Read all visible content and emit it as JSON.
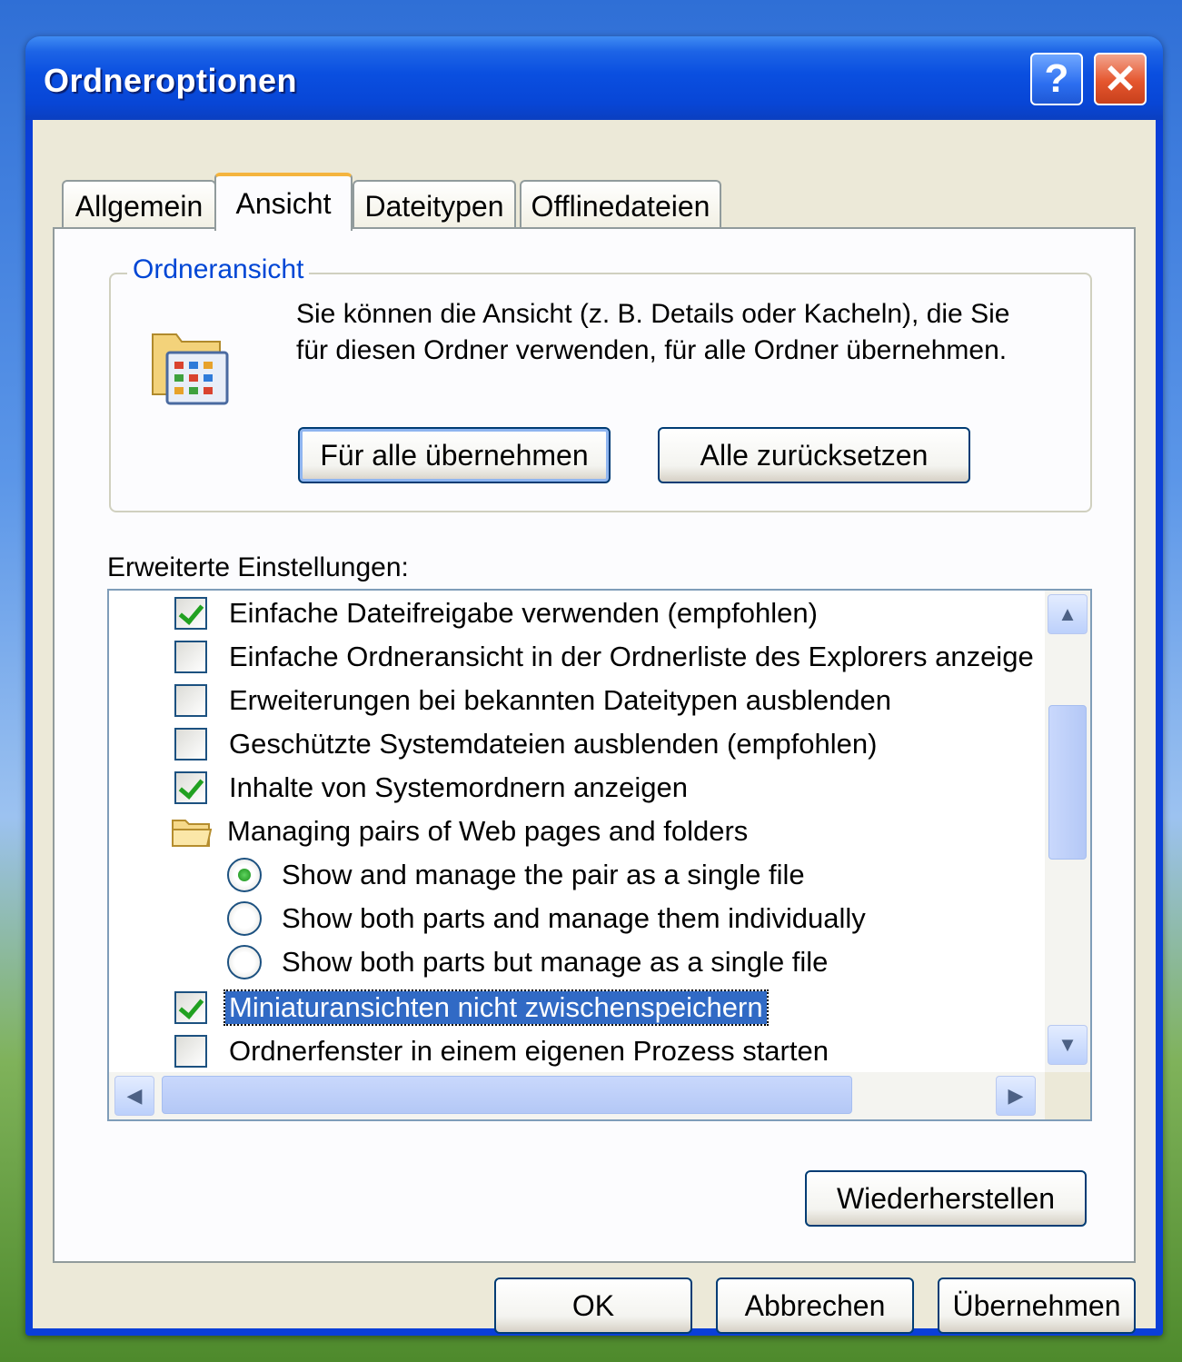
{
  "window": {
    "title": "Ordneroptionen",
    "help_label": "?",
    "close_label": "✕"
  },
  "tabs": [
    {
      "label": "Allgemein",
      "active": false
    },
    {
      "label": "Ansicht",
      "active": true
    },
    {
      "label": "Dateitypen",
      "active": false
    },
    {
      "label": "Offlinedateien",
      "active": false
    }
  ],
  "folder_view": {
    "title": "Ordneransicht",
    "description": "Sie können die Ansicht (z. B. Details oder Kacheln), die Sie für diesen Ordner verwenden, für alle Ordner übernehmen.",
    "apply_all_label": "Für alle übernehmen",
    "reset_all_label": "Alle zurücksetzen",
    "icon": "folder-view-icon"
  },
  "advanced": {
    "label": "Erweiterte Einstellungen:",
    "items": [
      {
        "type": "checkbox",
        "label": "Einfache Dateifreigabe verwenden (empfohlen)",
        "checked": true
      },
      {
        "type": "checkbox",
        "label": "Einfache Ordneransicht in der Ordnerliste des Explorers anzeige",
        "checked": false
      },
      {
        "type": "checkbox",
        "label": "Erweiterungen bei bekannten Dateitypen ausblenden",
        "checked": false
      },
      {
        "type": "checkbox",
        "label": "Geschützte Systemdateien ausblenden (empfohlen)",
        "checked": false
      },
      {
        "type": "checkbox",
        "label": "Inhalte von Systemordnern anzeigen",
        "checked": true
      },
      {
        "type": "folder",
        "label": "Managing pairs of Web pages and folders"
      },
      {
        "type": "radio",
        "label": "Show and manage the pair as a single file",
        "checked": true
      },
      {
        "type": "radio",
        "label": "Show both parts and manage them individually",
        "checked": false
      },
      {
        "type": "radio",
        "label": "Show both parts but manage as a single file",
        "checked": false
      },
      {
        "type": "checkbox",
        "label": "Miniaturansichten nicht zwischenspeichern",
        "checked": true,
        "selected": true
      },
      {
        "type": "checkbox",
        "label": "Ordnerfenster in einem eigenen Prozess starten",
        "checked": false
      }
    ],
    "restore_label": "Wiederherstellen"
  },
  "footer": {
    "ok_label": "OK",
    "cancel_label": "Abbrechen",
    "apply_label": "Übernehmen"
  },
  "colors": {
    "titlebar": "#0a4fe0",
    "dialog_bg": "#ece9d8",
    "group_title": "#0046d5",
    "selection": "#316ac5",
    "active_tab_accent": "#f4b43e"
  }
}
